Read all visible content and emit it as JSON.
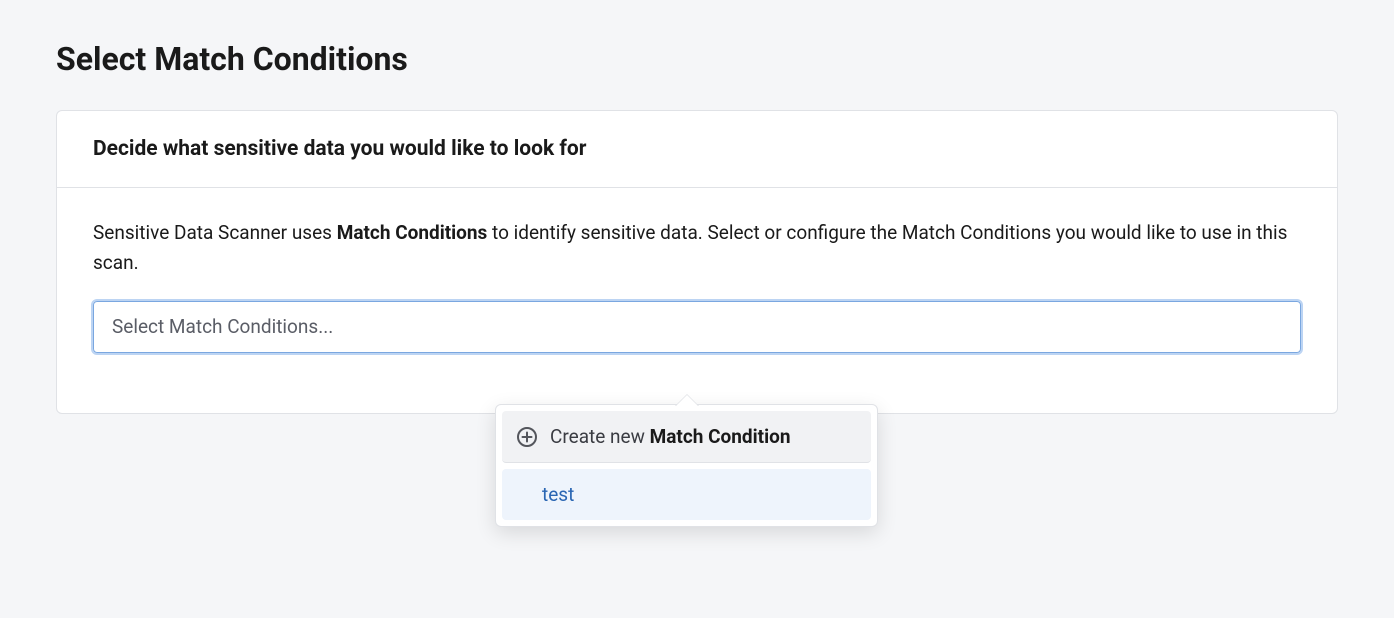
{
  "page": {
    "title": "Select Match Conditions"
  },
  "card": {
    "header_title": "Decide what sensitive data you would like to look for",
    "description_prefix": "Sensitive Data Scanner uses ",
    "description_bold": "Match Conditions",
    "description_suffix": " to identify sensitive data. Select or configure the Match Conditions you would like to use in this scan."
  },
  "select": {
    "placeholder": "Select Match Conditions..."
  },
  "dropdown": {
    "create_prefix": "Create new ",
    "create_bold": "Match Condition",
    "options": [
      {
        "label": "test"
      }
    ]
  }
}
